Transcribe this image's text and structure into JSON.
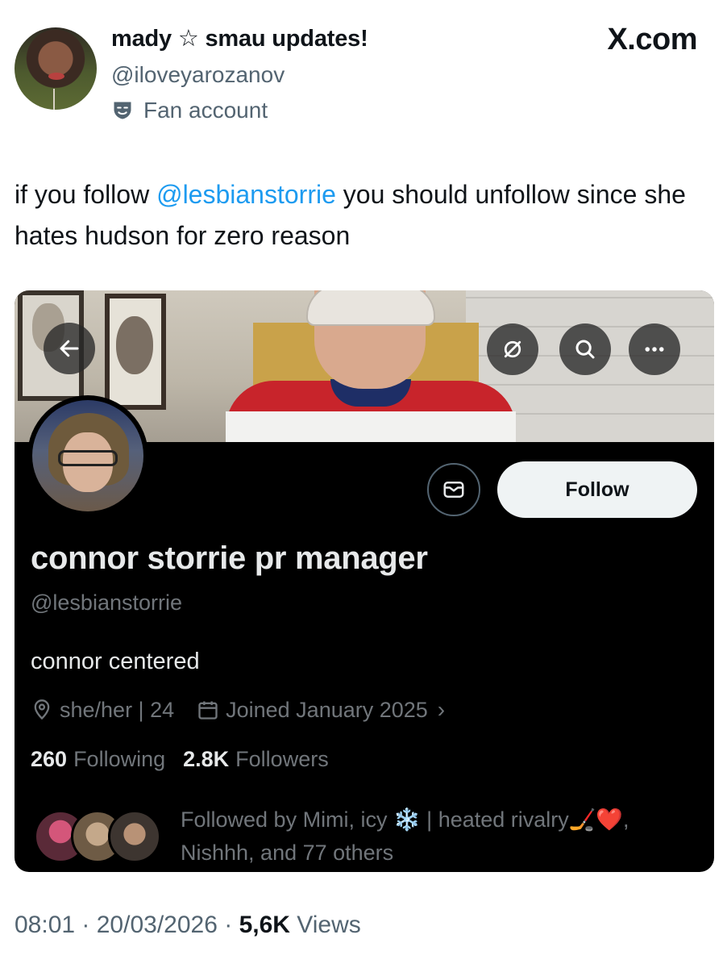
{
  "tweet": {
    "author_name": "mady ☆ smau updates!",
    "author_handle": "@iloveyarozanov",
    "label": "Fan account",
    "site_logo": "X.com",
    "text_before": "if you follow ",
    "mention": "@lesbianstorrie",
    "text_after": " you should unfollow since she hates hudson for zero reason",
    "time": "08:01",
    "date": "20/03/2026",
    "views_count": "5,6K",
    "views_label": "Views"
  },
  "embedded_profile": {
    "name": "connor storrie pr manager",
    "handle": "@lesbianstorrie",
    "bio": "connor centered",
    "location": "she/her | 24",
    "joined": "Joined January 2025",
    "following_count": "260",
    "following_label": "Following",
    "followers_count": "2.8K",
    "followers_label": "Followers",
    "follow_button": "Follow",
    "followed_by_line1": "Followed by Mimi, icy ❄️ | heated rivalry🏒❤️,",
    "followed_by_line2": "Nishhh, and 77 others"
  },
  "icons": [
    "theater-mask-icon",
    "back-arrow-icon",
    "translate-icon",
    "search-icon",
    "more-icon",
    "message-icon",
    "location-icon",
    "calendar-icon",
    "chevron-right-icon"
  ],
  "colors": {
    "link": "#1d9bf0",
    "muted": "#536471",
    "card_bg": "#000000",
    "card_text": "#e7e9ea",
    "card_muted": "#71767b"
  }
}
